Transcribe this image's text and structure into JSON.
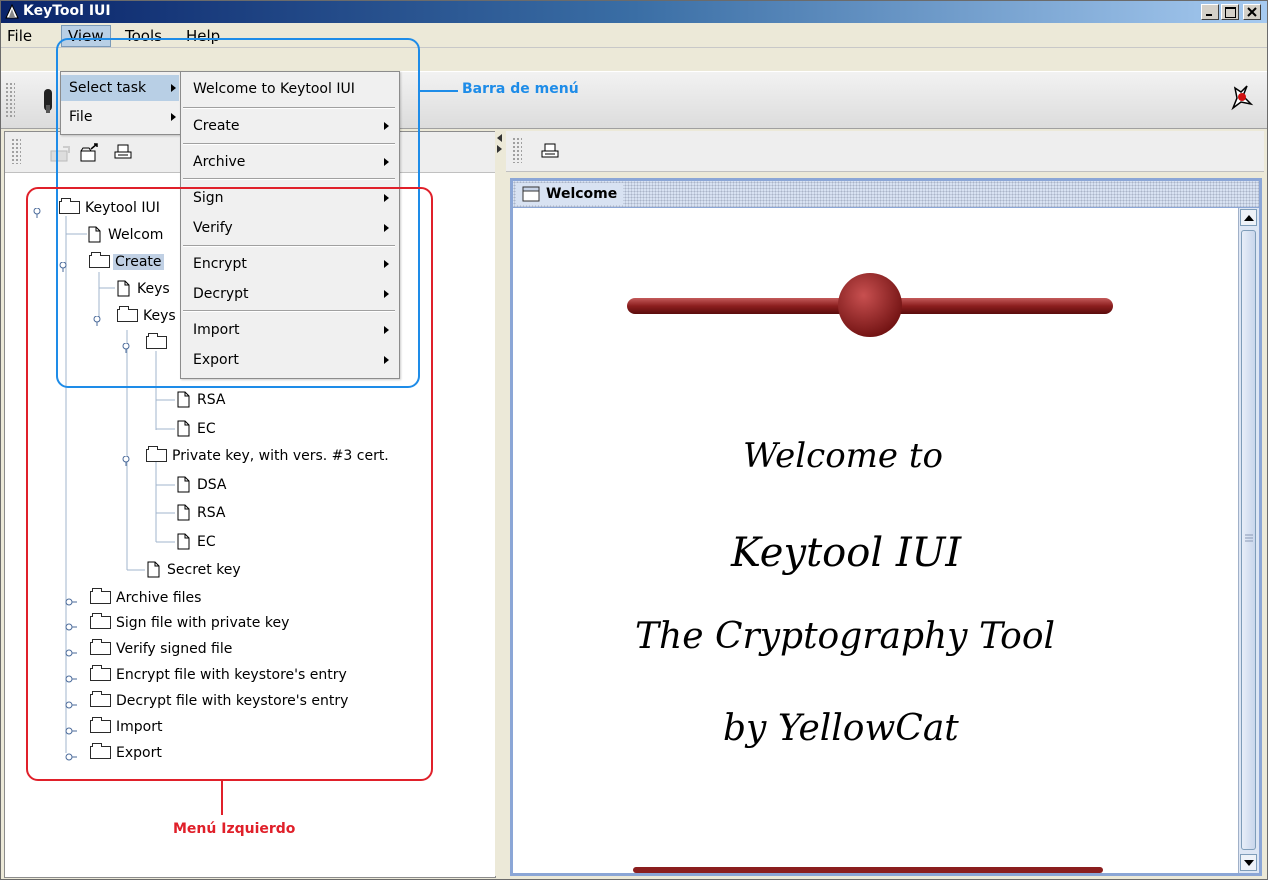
{
  "window": {
    "title": "KeyTool IUI"
  },
  "menubar": {
    "items": [
      "File",
      "View",
      "Tools",
      "Help"
    ]
  },
  "view_menu": {
    "items": [
      "Select task",
      "File"
    ]
  },
  "select_task_menu": {
    "items": [
      "Welcome to Keytool IUI",
      "Create",
      "Archive",
      "Sign",
      "Verify",
      "Encrypt",
      "Decrypt",
      "Import",
      "Export"
    ]
  },
  "tree": {
    "root": "Keytool IUI",
    "welcome": "Welcom",
    "create": "Create",
    "keys1": "Keys",
    "keys2": "Keys",
    "rsa1": "RSA",
    "ec1": "EC",
    "private_key_v3": "Private key, with vers. #3 cert.",
    "dsa": "DSA",
    "rsa2": "RSA",
    "ec2": "EC",
    "secret_key": "Secret key",
    "archive_files": "Archive files",
    "sign_file": "Sign file with private key",
    "verify_signed": "Verify signed file",
    "encrypt_file": "Encrypt file with keystore's entry",
    "decrypt_file": "Decrypt file with keystore's entry",
    "import": "Import",
    "export": "Export"
  },
  "welcome_frame": {
    "title": "Welcome",
    "lines": [
      "Welcome to",
      "Keytool IUI",
      "The Cryptography Tool",
      "by YellowCat"
    ]
  },
  "annotations": {
    "menu_bar": "Barra de menú",
    "left_menu": "Menú Izquierdo"
  },
  "colors": {
    "annotation_blue": "#1e8ce8",
    "annotation_red": "#e0202a",
    "banner": "#8b1e1e"
  }
}
